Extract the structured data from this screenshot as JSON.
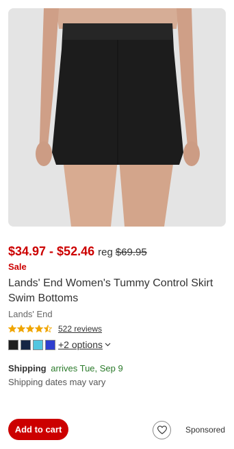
{
  "product": {
    "image_alt": "Black swim skirt",
    "price_range": "$34.97 - $52.46",
    "reg_label": "reg",
    "reg_price": "$69.95",
    "sale_label": "Sale",
    "title": "Lands' End Women's Tummy Control Skirt Swim Bottoms",
    "brand": "Lands' End",
    "rating": 4.5,
    "rating_max": 5,
    "reviews_label": "522 reviews",
    "swatches": [
      "#1e1e1e",
      "#152544",
      "#52c6e0",
      "#2f3fcf"
    ],
    "more_options_label": "+2 options",
    "chevron_icon": "chevron-down-icon",
    "heart_icon": "heart-icon"
  },
  "shipping": {
    "label": "Shipping",
    "arrival": "arrives Tue, Sep 9",
    "note": "Shipping dates may vary"
  },
  "actions": {
    "add_to_cart_label": "Add to cart",
    "sponsored_label": "Sponsored"
  },
  "colors": {
    "price": "#cc0000",
    "star": "#f0a500",
    "shipping_green": "#2a7a2a",
    "button_bg": "#cc0000"
  }
}
